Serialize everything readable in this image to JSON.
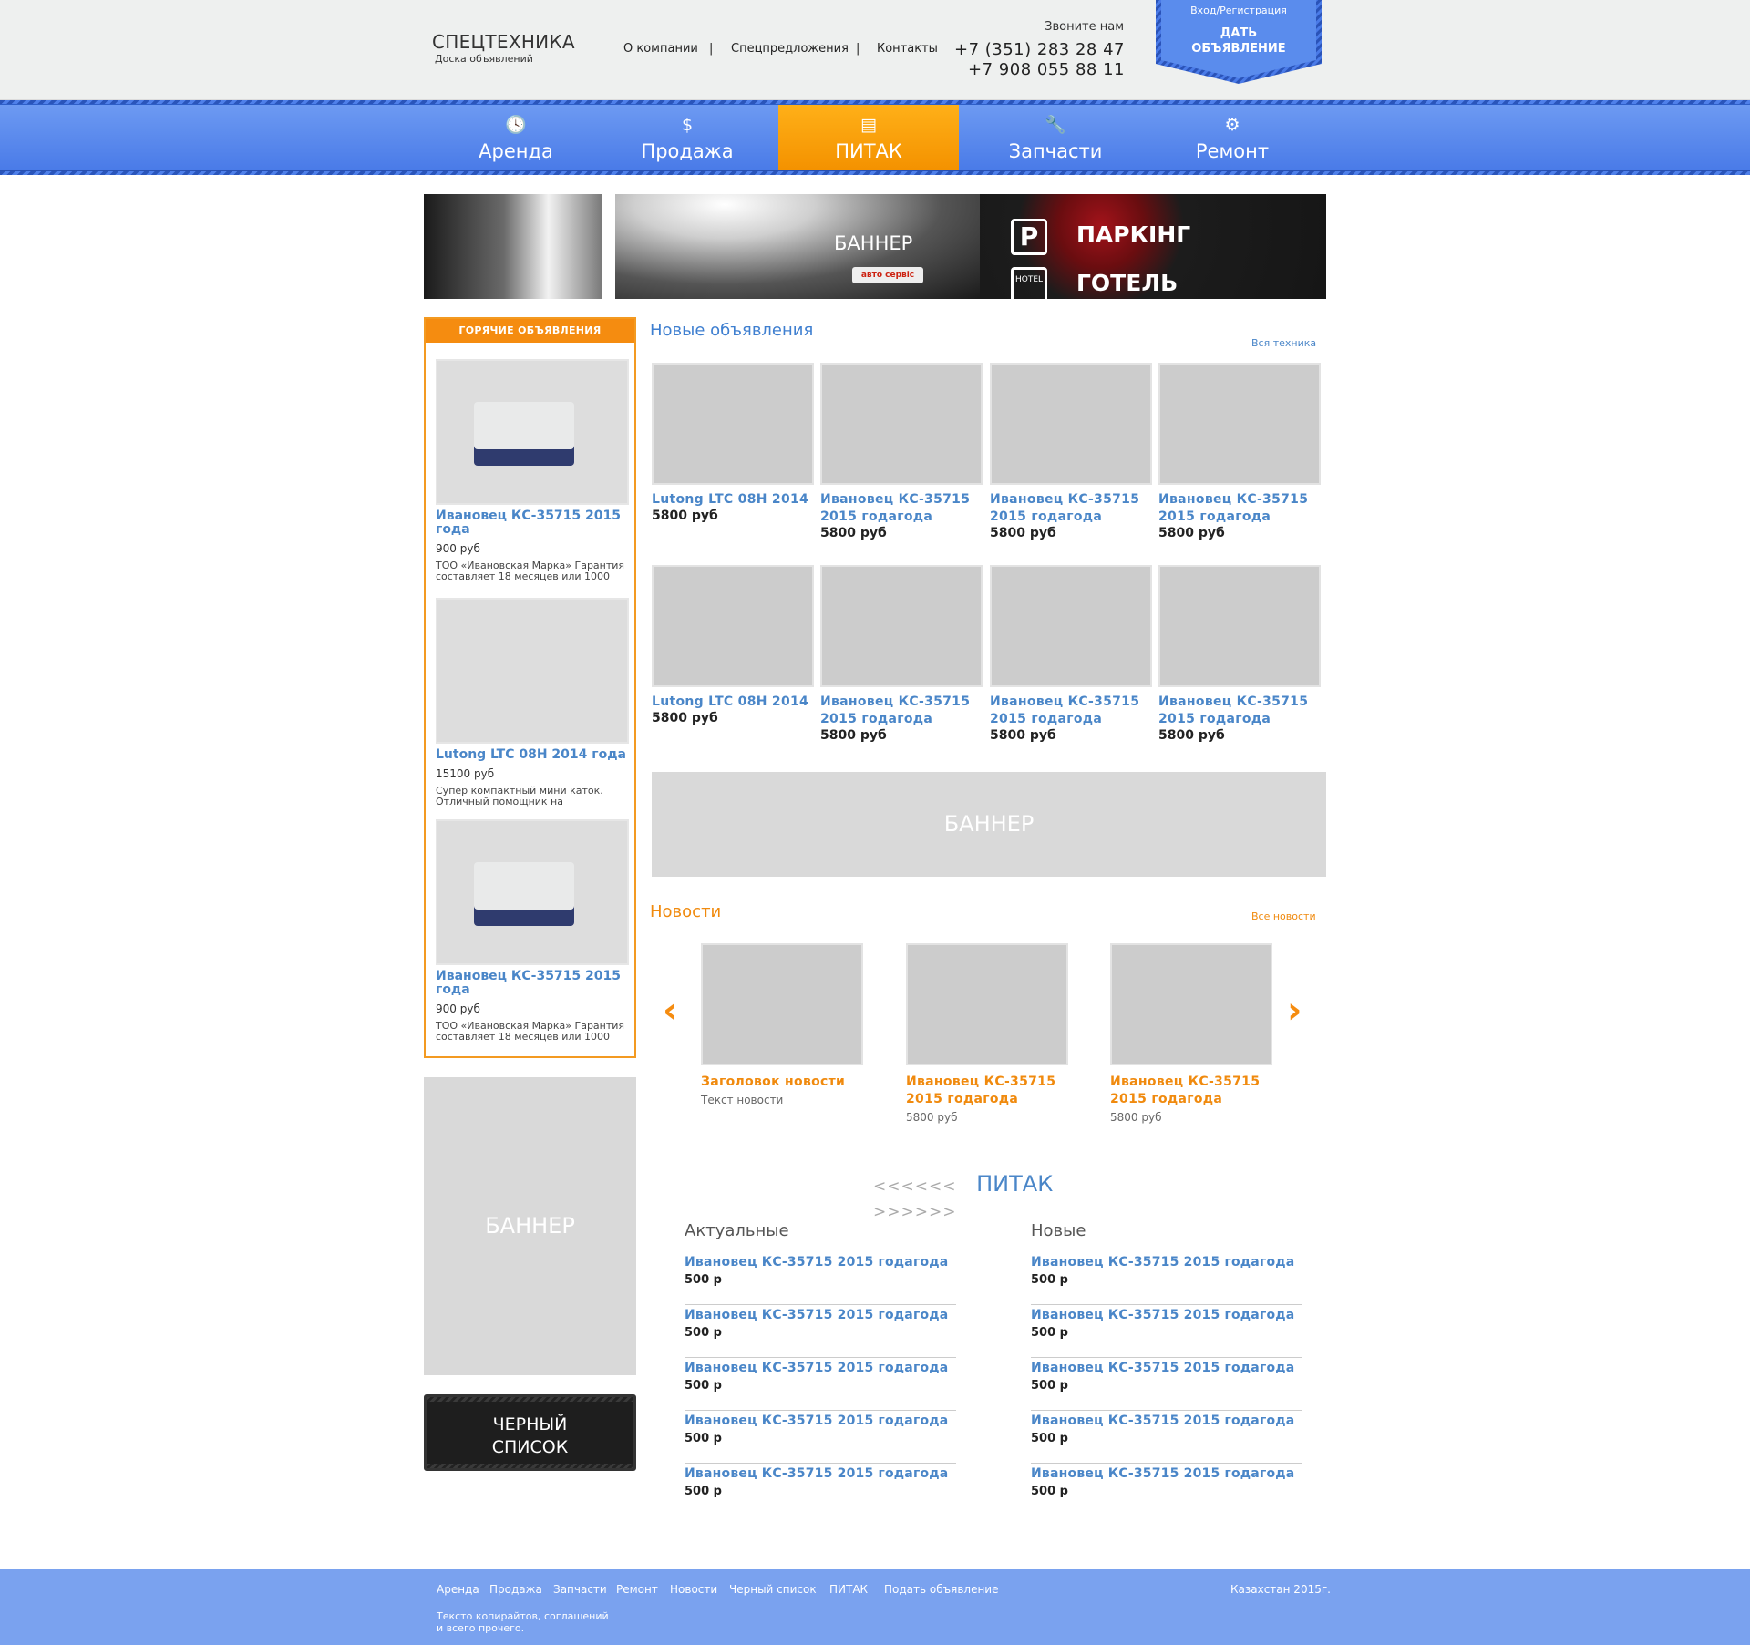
{
  "header": {
    "logo_title": "СПЕЦТЕХНИКА",
    "logo_subtitle": "Доска объявлений",
    "top_nav": [
      "О компании",
      "Спецпредложения",
      "Контакты"
    ],
    "separator": "|",
    "call_label": "Звоните нам",
    "phones": [
      "+7 (351) 283 28 47",
      "+7 908 055 88 11"
    ],
    "badge_login": "Вход/Регистрация",
    "badge_action_line1": "ДАТЬ",
    "badge_action_line2": "ОБЪЯВЛЕНИЕ"
  },
  "nav": [
    {
      "label": "Аренда",
      "icon": "clock-icon",
      "glyph": "🕓"
    },
    {
      "label": "Продажа",
      "icon": "dollar-icon",
      "glyph": "$"
    },
    {
      "label": "ПИТАК",
      "icon": "document-icon",
      "glyph": "▤"
    },
    {
      "label": "Запчасти",
      "icon": "wrench-icon",
      "glyph": "🔧"
    },
    {
      "label": "Ремонт",
      "icon": "gear-icon",
      "glyph": "⚙"
    }
  ],
  "top_banner": {
    "label": "БАННЕР",
    "logo_text": "авто сервіс",
    "sign1": "ПАРКІНГ",
    "sign2": "ГОТЕЛЬ",
    "sign_p": "P",
    "sign_hotel": "HOTEL"
  },
  "hot": {
    "heading": "ГОРЯЧИЕ ОБЪЯВЛЕНИЯ",
    "items": [
      {
        "title": "Ивановец КС-35715 2015 года",
        "price": "900 руб",
        "desc": "ТОО «Ивановская Марка» Гарантия составляет 18 месяцев или 1000"
      },
      {
        "title": "Lutong LTC 08H 2014 года",
        "price": "15100 руб",
        "desc": "Супер компактный мини каток. Отличный помощник на"
      },
      {
        "title": "Ивановец КС-35715 2015 года",
        "price": "900 руб",
        "desc": "ТОО «Ивановская Марка» Гарантия составляет 18 месяцев или 1000"
      }
    ]
  },
  "side_banner": "БАННЕР",
  "blacklist": {
    "line1": "ЧЕРНЫЙ",
    "line2": "СПИСОК"
  },
  "new_ads": {
    "title": "Новые объявления",
    "all_link": "Вся техника",
    "cards": [
      {
        "title": "Lutong LTC 08H 2014",
        "price": "5800 руб"
      },
      {
        "title": "Ивановец КС-35715 2015 годагода",
        "price": "5800 руб"
      },
      {
        "title": "Ивановец КС-35715 2015 годагода",
        "price": "5800 руб"
      },
      {
        "title": "Ивановец КС-35715 2015 годагода",
        "price": "5800 руб"
      },
      {
        "title": "Lutong LTC 08H 2014",
        "price": "5800 руб"
      },
      {
        "title": "Ивановец КС-35715 2015 годагода",
        "price": "5800 руб"
      },
      {
        "title": "Ивановец КС-35715 2015 годагода",
        "price": "5800 руб"
      },
      {
        "title": "Ивановец КС-35715 2015 годагода",
        "price": "5800 руб"
      }
    ]
  },
  "mid_banner": "БАННЕР",
  "news": {
    "title": "Новости",
    "all_link": "Все новости",
    "prev": "‹",
    "next": "›",
    "items": [
      {
        "title": "Заголовок новости",
        "text": "Текст новости"
      },
      {
        "title": "Ивановец КС-35715 2015 годагода",
        "text": "5800 руб"
      },
      {
        "title": "Ивановец КС-35715 2015 годагода",
        "text": "5800 руб"
      }
    ]
  },
  "pitak": {
    "left_deco": "<<<<<<",
    "title": "ПИТАК",
    "right_deco": ">>>>>>",
    "col1_title": "Актуальные",
    "col2_title": "Новые",
    "rows": [
      {
        "title": "Ивановец КС-35715 2015 годагода",
        "price": "500 р"
      },
      {
        "title": "Ивановец КС-35715 2015 годагода",
        "price": "500 р"
      },
      {
        "title": "Ивановец КС-35715 2015 годагода",
        "price": "500 р"
      },
      {
        "title": "Ивановец КС-35715 2015 годагода",
        "price": "500 р"
      },
      {
        "title": "Ивановец КС-35715 2015 годагода",
        "price": "500 р"
      }
    ]
  },
  "footer": {
    "links": [
      "Аренда",
      "Продажа",
      "Запчасти",
      "Ремонт",
      "Новости",
      "Черный список",
      "ПИТАК",
      "Подать объявление"
    ],
    "copy_line1": "Тексто копирайтов, соглашений",
    "copy_line2": "и всего прочего.",
    "year": "Казахстан 2015г."
  }
}
